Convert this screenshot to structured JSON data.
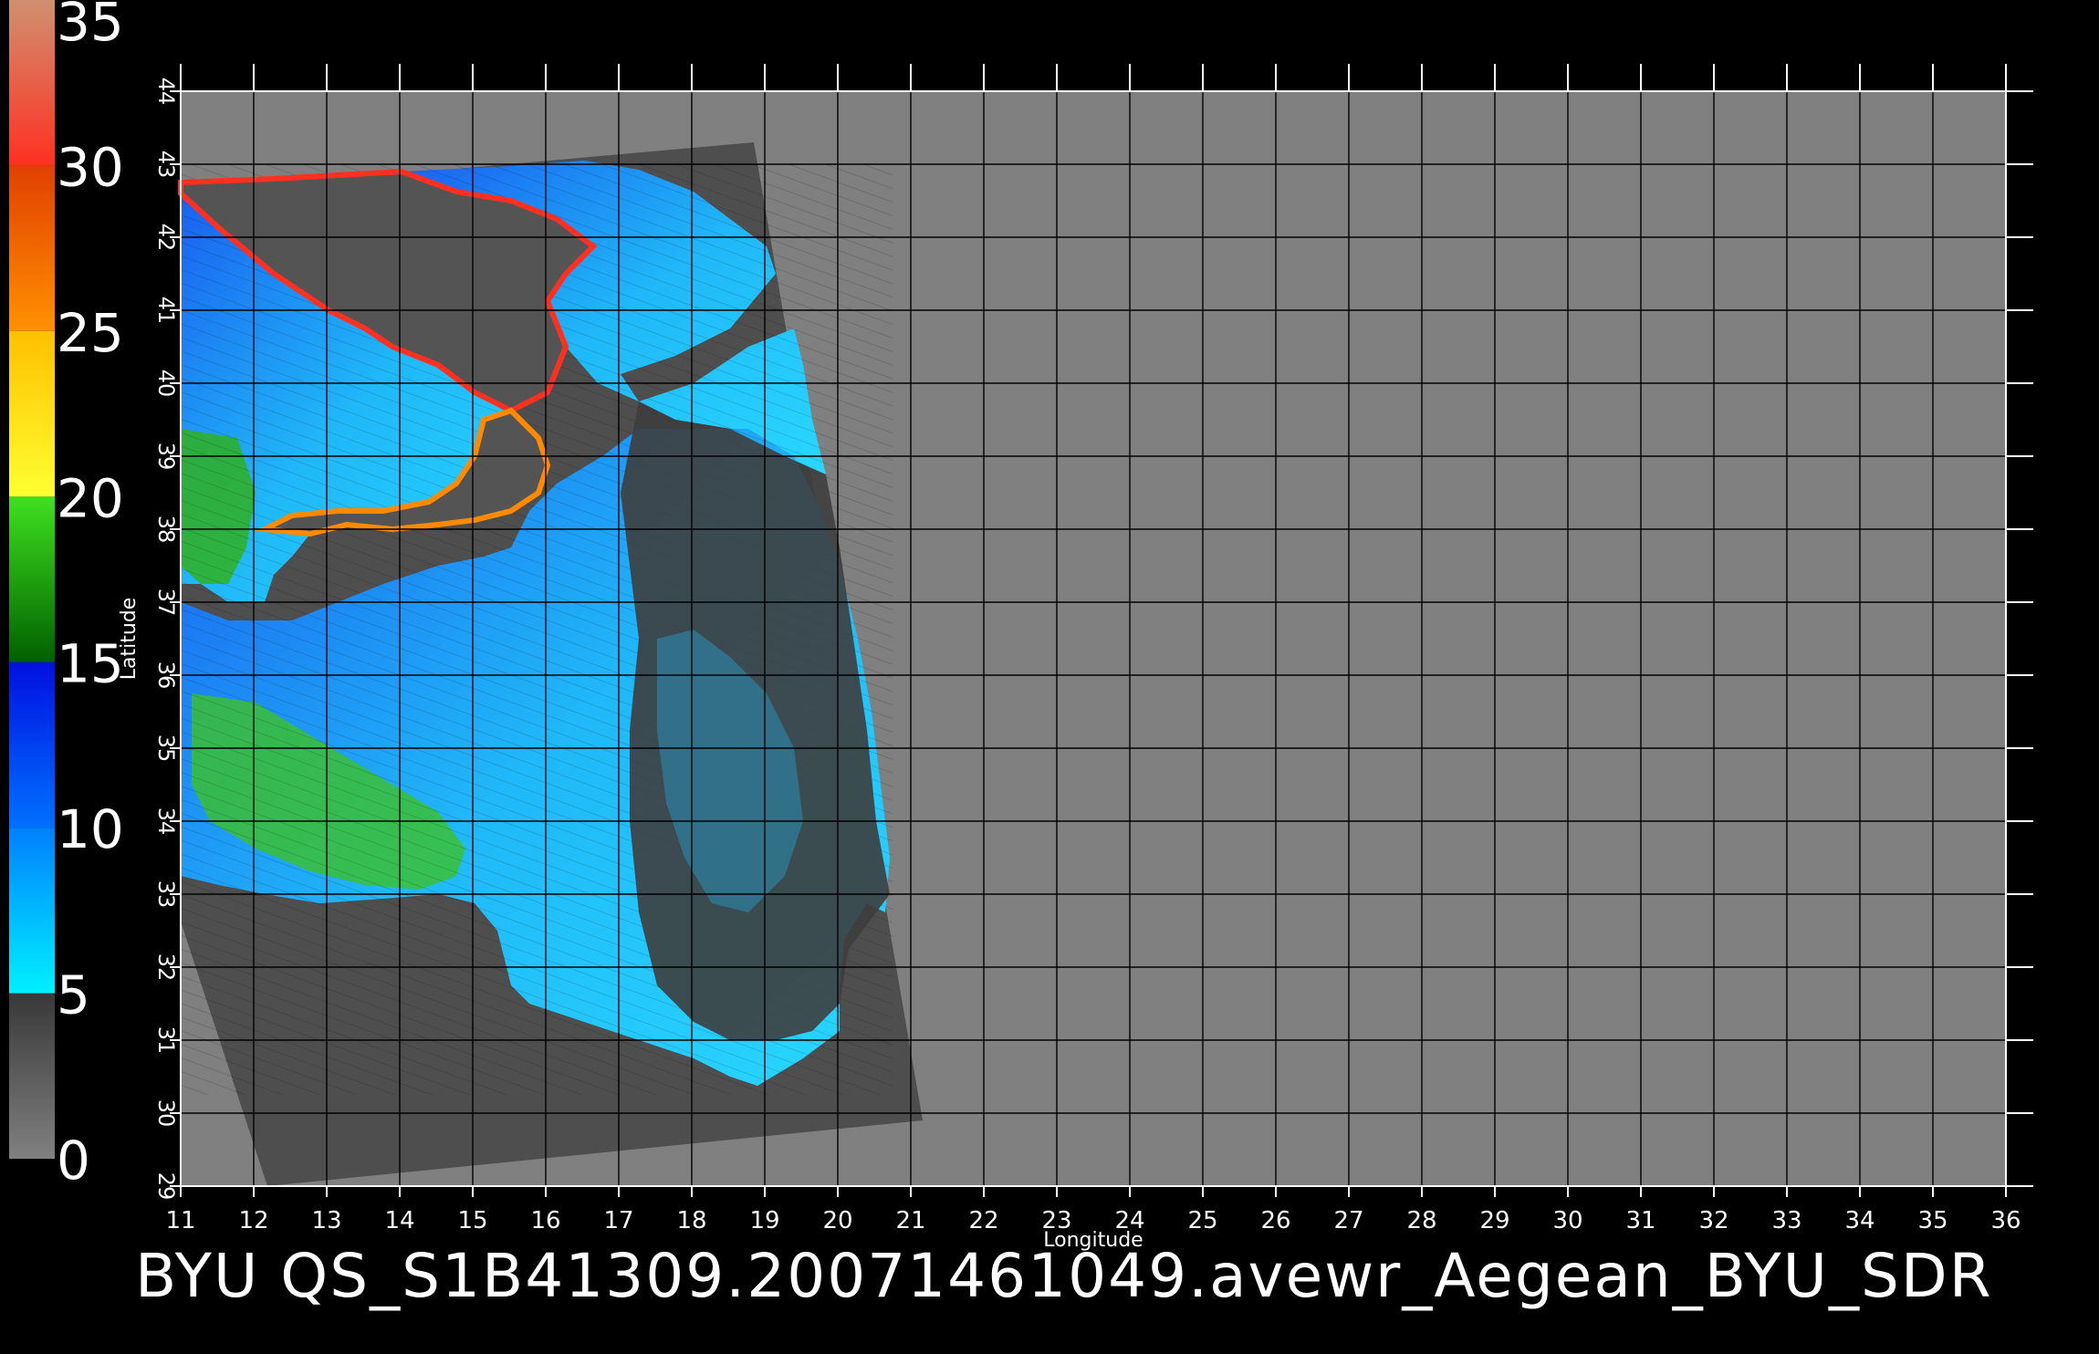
{
  "caption": "BYU  QS_S1B41309.20071461049.avewr_Aegean_BYU_SDR",
  "axes": {
    "xlabel": "Longitude",
    "ylabel": "Latitude",
    "lon_range": [
      11,
      36
    ],
    "lat_range": [
      29,
      44
    ],
    "lon_ticks": [
      "11",
      "12",
      "13",
      "14",
      "15",
      "16",
      "17",
      "18",
      "19",
      "20",
      "21",
      "22",
      "23",
      "24",
      "25",
      "26",
      "27",
      "28",
      "29",
      "30",
      "31",
      "32",
      "33",
      "34",
      "35",
      "36"
    ],
    "lat_ticks": [
      "29",
      "30",
      "31",
      "32",
      "33",
      "34",
      "35",
      "36",
      "37",
      "38",
      "39",
      "40",
      "41",
      "42",
      "43",
      "44"
    ]
  },
  "color_scale": {
    "range": [
      0,
      35
    ],
    "labels": [
      "0",
      "5",
      "10",
      "15",
      "20",
      "25",
      "30",
      "35"
    ],
    "stops": [
      {
        "from": 0,
        "to": 5,
        "colors": [
          "#808080",
          "#383838"
        ]
      },
      {
        "from": 5,
        "to": 10,
        "colors": [
          "#00f0ff",
          "#0080ff"
        ]
      },
      {
        "from": 10,
        "to": 15,
        "colors": [
          "#0070ff",
          "#0010e0"
        ]
      },
      {
        "from": 15,
        "to": 20,
        "colors": [
          "#006000",
          "#40e020"
        ]
      },
      {
        "from": 20,
        "to": 25,
        "colors": [
          "#ffff30",
          "#ffc000"
        ]
      },
      {
        "from": 25,
        "to": 30,
        "colors": [
          "#ff9000",
          "#e04000"
        ]
      },
      {
        "from": 30,
        "to": 35,
        "colors": [
          "#ff3020",
          "#d09070"
        ]
      }
    ]
  },
  "colors": {
    "background": "#000000",
    "no_data": "#808080",
    "swath_land": "#505050",
    "sea_light": "#20c8f8",
    "sea_blue": "#1070f0",
    "land_dark": "#4a4a4a",
    "grid": "#000000"
  }
}
